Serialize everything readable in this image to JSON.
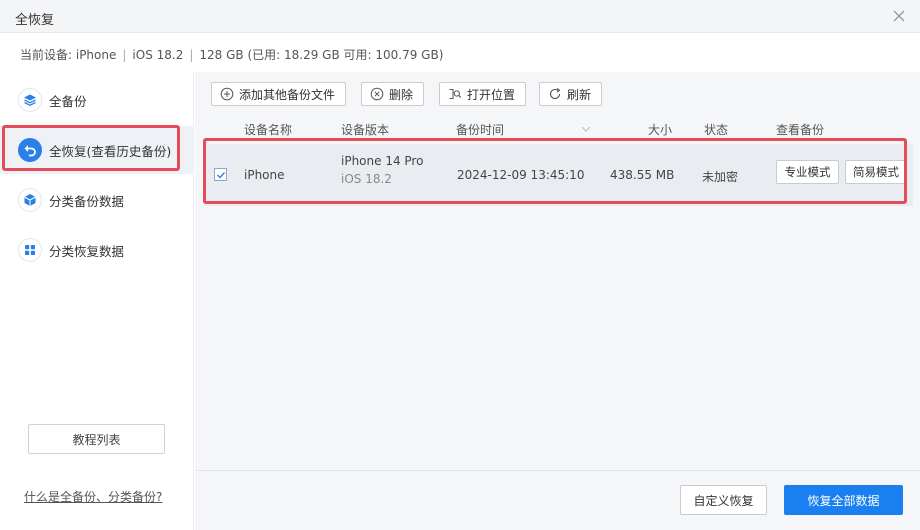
{
  "window": {
    "title": "全恢复"
  },
  "device": {
    "label": "当前设备: iPhone",
    "os": "iOS 18.2",
    "storage": "128 GB (已用: 18.29 GB 可用: 100.79 GB)"
  },
  "sidebar": {
    "items": [
      {
        "label": "全备份",
        "icon": "layers-icon"
      },
      {
        "label": "全恢复(查看历史备份)",
        "icon": "undo-arrow-icon",
        "active": true
      },
      {
        "label": "分类备份数据",
        "icon": "cube-icon"
      },
      {
        "label": "分类恢复数据",
        "icon": "grid-icon"
      }
    ],
    "tutorial_label": "教程列表",
    "help_link": "什么是全备份、分类备份?"
  },
  "toolbar": {
    "add_label": "添加其他备份文件",
    "delete_label": "删除",
    "open_location_label": "打开位置",
    "refresh_label": "刷新"
  },
  "table": {
    "columns": [
      "设备名称",
      "设备版本",
      "备份时间",
      "大小",
      "状态",
      "查看备份"
    ],
    "rows": [
      {
        "checked": true,
        "name": "iPhone",
        "model": "iPhone 14 Pro",
        "os": "iOS 18.2",
        "time": "2024-12-09 13:45:10",
        "size": "438.55 MB",
        "status": "未加密",
        "pro_mode_label": "专业模式",
        "simple_mode_label": "简易模式"
      }
    ]
  },
  "footer": {
    "custom_restore_label": "自定义恢复",
    "restore_all_label": "恢复全部数据"
  },
  "colors": {
    "accent": "#1a80f2",
    "highlight": "#e44c5a"
  }
}
